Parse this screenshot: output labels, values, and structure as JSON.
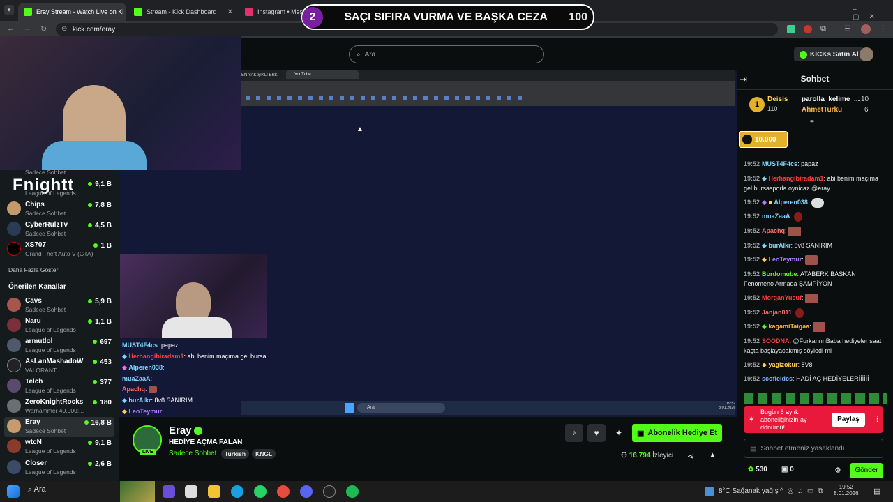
{
  "browser": {
    "tabs": [
      {
        "label": "Eray Stream - Watch Live on Ki",
        "active": true
      },
      {
        "label": "Stream - Kick Dashboard",
        "active": false
      },
      {
        "label": "Instagram • Mesajl",
        "active": false
      }
    ],
    "url": "kick.com/eray"
  },
  "banner": {
    "number": "2",
    "text": "SAÇI SIFIRA VURMA VE BAŞKA CEZA",
    "score": "100"
  },
  "header": {
    "search_placeholder": "Ara",
    "kicks_label": "KICKs Satın Al"
  },
  "sidebar": {
    "watermark": "Fnightt",
    "top_partial": "Sadece Sohbet",
    "following": [
      {
        "name": "",
        "category": "League of Legends",
        "viewers": "9,1 B"
      },
      {
        "name": "Chips",
        "category": "Sadece Sohbet",
        "viewers": "7,8 B"
      },
      {
        "name": "CyberRulzTv",
        "category": "Sadece Sohbet",
        "viewers": "4,5 B"
      },
      {
        "name": "XS707",
        "category": "Grand Theft Auto V (GTA)",
        "viewers": "1 B"
      }
    ],
    "show_more": "Daha Fazla Göster",
    "recommended_title": "Önerilen Kanallar",
    "recommended": [
      {
        "name": "Cavs",
        "category": "Sadece Sohbet",
        "viewers": "5,9 B"
      },
      {
        "name": "Naru",
        "category": "League of Legends",
        "viewers": "1,1 B"
      },
      {
        "name": "armutlol",
        "category": "League of Legends",
        "viewers": "697"
      },
      {
        "name": "AsLanMashadoW",
        "category": "VALORANT",
        "viewers": "453"
      },
      {
        "name": "Telch",
        "category": "League of Legends",
        "viewers": "377"
      },
      {
        "name": "ZeroKnightRocks",
        "category": "Warhammer 40,000:...",
        "viewers": "180"
      },
      {
        "name": "Eray",
        "category": "Sadece Sohbet",
        "viewers": "16,8 B"
      },
      {
        "name": "wtcN",
        "category": "League of Legends",
        "viewers": "9,1 B"
      },
      {
        "name": "Closer",
        "category": "League of Legends",
        "viewers": "2,6 B"
      }
    ]
  },
  "video": {
    "inner_tabs": [
      "EN YAKIŞIKLI ERK",
      "YouTube"
    ],
    "inner_taskbar_search": "Ara",
    "inner_clock": "19:52",
    "inner_date": "8.01.2026",
    "overlay_chat": [
      {
        "user": "MUST4F4cs",
        "text": ": papaz",
        "color": "#7fd7ff"
      },
      {
        "user": "Herhangibiradam1",
        "text": ": abi benim maçıma gel bursa",
        "color": "#ff3b3b"
      },
      {
        "user": "Alperen038",
        "text": ":",
        "color": "#7fd7ff"
      },
      {
        "user": "muaZaaA",
        "text": ":",
        "color": "#7fd7ff"
      },
      {
        "user": "Apachq",
        "text": ":",
        "color": "#ff6b6b"
      },
      {
        "user": "burAlkr",
        "text": ": 8v8 SANIRIM",
        "color": "#7fd7ff"
      },
      {
        "user": "LeoTeymur",
        "text": ":",
        "color": "#b07cff"
      }
    ]
  },
  "stream": {
    "channel": "Eray",
    "title": "HEDİYE AÇMA FALAN",
    "category": "Sadece Sohbet",
    "tags": [
      "Turkish",
      "KNGL"
    ],
    "live": "LIVE",
    "sub_gift": "Abonelik Hediye Et",
    "viewers": "16.794",
    "viewers_label": "İzleyici"
  },
  "chat": {
    "title": "Sohbet",
    "leaderboard": {
      "rank": "1",
      "first": {
        "name": "Deisis",
        "value": "110"
      },
      "second": {
        "name": "parolla_kelime_...",
        "value": "10"
      },
      "third": {
        "name": "AhmetTurku",
        "value": "6"
      }
    },
    "kicks_badge": "10.000",
    "messages": [
      {
        "time": "19:52",
        "user": "MUST4F4cs",
        "color": "#7fd7ff",
        "text": ": papaz"
      },
      {
        "time": "19:52",
        "user": "Herhangibiradam1",
        "color": "#ff3b3b",
        "text": ": abi benim maçıma gel bursasporla oynicaz @eray"
      },
      {
        "time": "19:52",
        "user": "Alperen038",
        "color": "#7fd7ff",
        "text": ":"
      },
      {
        "time": "19:52",
        "user": "muaZaaA",
        "color": "#7fd7ff",
        "text": ":"
      },
      {
        "time": "19:52",
        "user": "Apachq",
        "color": "#ff6b6b",
        "text": ":"
      },
      {
        "time": "19:52",
        "user": "burAlkr",
        "color": "#7fd7ff",
        "text": ": 8v8 SANIRIM"
      },
      {
        "time": "19:52",
        "user": "LeoTeymur",
        "color": "#b07cff",
        "text": ":"
      },
      {
        "time": "19:52",
        "user": "Bordomube",
        "color": "#53fc18",
        "text": ": ATABERK BAŞKAN Fenomeno Armada ŞAMPİYON"
      },
      {
        "time": "19:52",
        "user": "MorganYusuf",
        "color": "#ff3b3b",
        "text": ":"
      },
      {
        "time": "19:52",
        "user": "Janjan011",
        "color": "#ff6b6b",
        "text": ":"
      },
      {
        "time": "19:52",
        "user": "kagamiTaigaa",
        "color": "#ffb347",
        "text": ":"
      },
      {
        "time": "19:52",
        "user": "SOODNA",
        "color": "#ff3b3b",
        "text": ": @FurkannnBaba hediyeler saat kaçta başlayacakmış söyledi mi"
      },
      {
        "time": "19:52",
        "user": "yagizokur",
        "color": "#ffd24a",
        "text": ": 8V8"
      },
      {
        "time": "19:52",
        "user": "scofieldcs",
        "color": "#7fb4ff",
        "text": ": HADİ AÇ HEDİYELERİİİİİİ"
      }
    ],
    "promo_text": "Bugün 8 aylık aboneliğinizin ay dönümü!",
    "share_label": "Paylaş",
    "input_placeholder": "Sohbet etmeniz yasaklandı",
    "points": "530",
    "gifts": "0",
    "send_label": "Gönder"
  },
  "taskbar": {
    "search": "Ara",
    "weather": "8°C  Sağanak yağış",
    "time": "19:52",
    "date": "8.01.2026"
  }
}
